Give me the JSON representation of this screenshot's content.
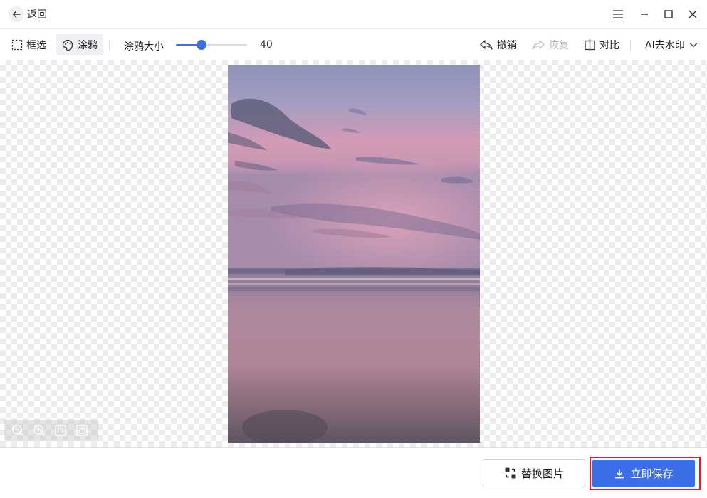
{
  "titlebar": {
    "back_label": "返回",
    "icons": [
      "arrow-left-icon",
      "menu-icon",
      "minimize-icon",
      "maximize-icon",
      "close-icon"
    ]
  },
  "toolbar": {
    "select_label": "框选",
    "brush_label": "涂鸦",
    "brush_size_label": "涂鸦大小",
    "brush_size_value": "40",
    "brush_size_fraction": 0.36,
    "undo_label": "撤销",
    "redo_label": "恢复",
    "compare_label": "对比",
    "mode_label": "AI去水印"
  },
  "canvas": {
    "zoom_controls": [
      "zoom-out-icon",
      "zoom-in-icon",
      "original-size-icon",
      "fit-screen-icon"
    ]
  },
  "footer": {
    "replace_label": "替换图片",
    "save_label": "立即保存"
  },
  "colors": {
    "accent": "#3b6fe8",
    "highlight_border": "#d42424"
  }
}
